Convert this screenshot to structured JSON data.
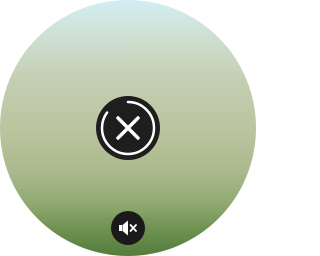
{
  "background": {
    "gradient_colors": [
      "#d3eef5",
      "#c4d0b4",
      "#bcc4a0",
      "#8ea86f",
      "#557c3d"
    ]
  },
  "cancel_button": {
    "icon": "close-icon",
    "background_color": "#1e1e1e",
    "icon_color": "#ffffff",
    "progress": 0.85
  },
  "mute_button": {
    "icon": "volume-muted-icon",
    "background_color": "#1a1a1a",
    "icon_color": "#ffffff"
  }
}
